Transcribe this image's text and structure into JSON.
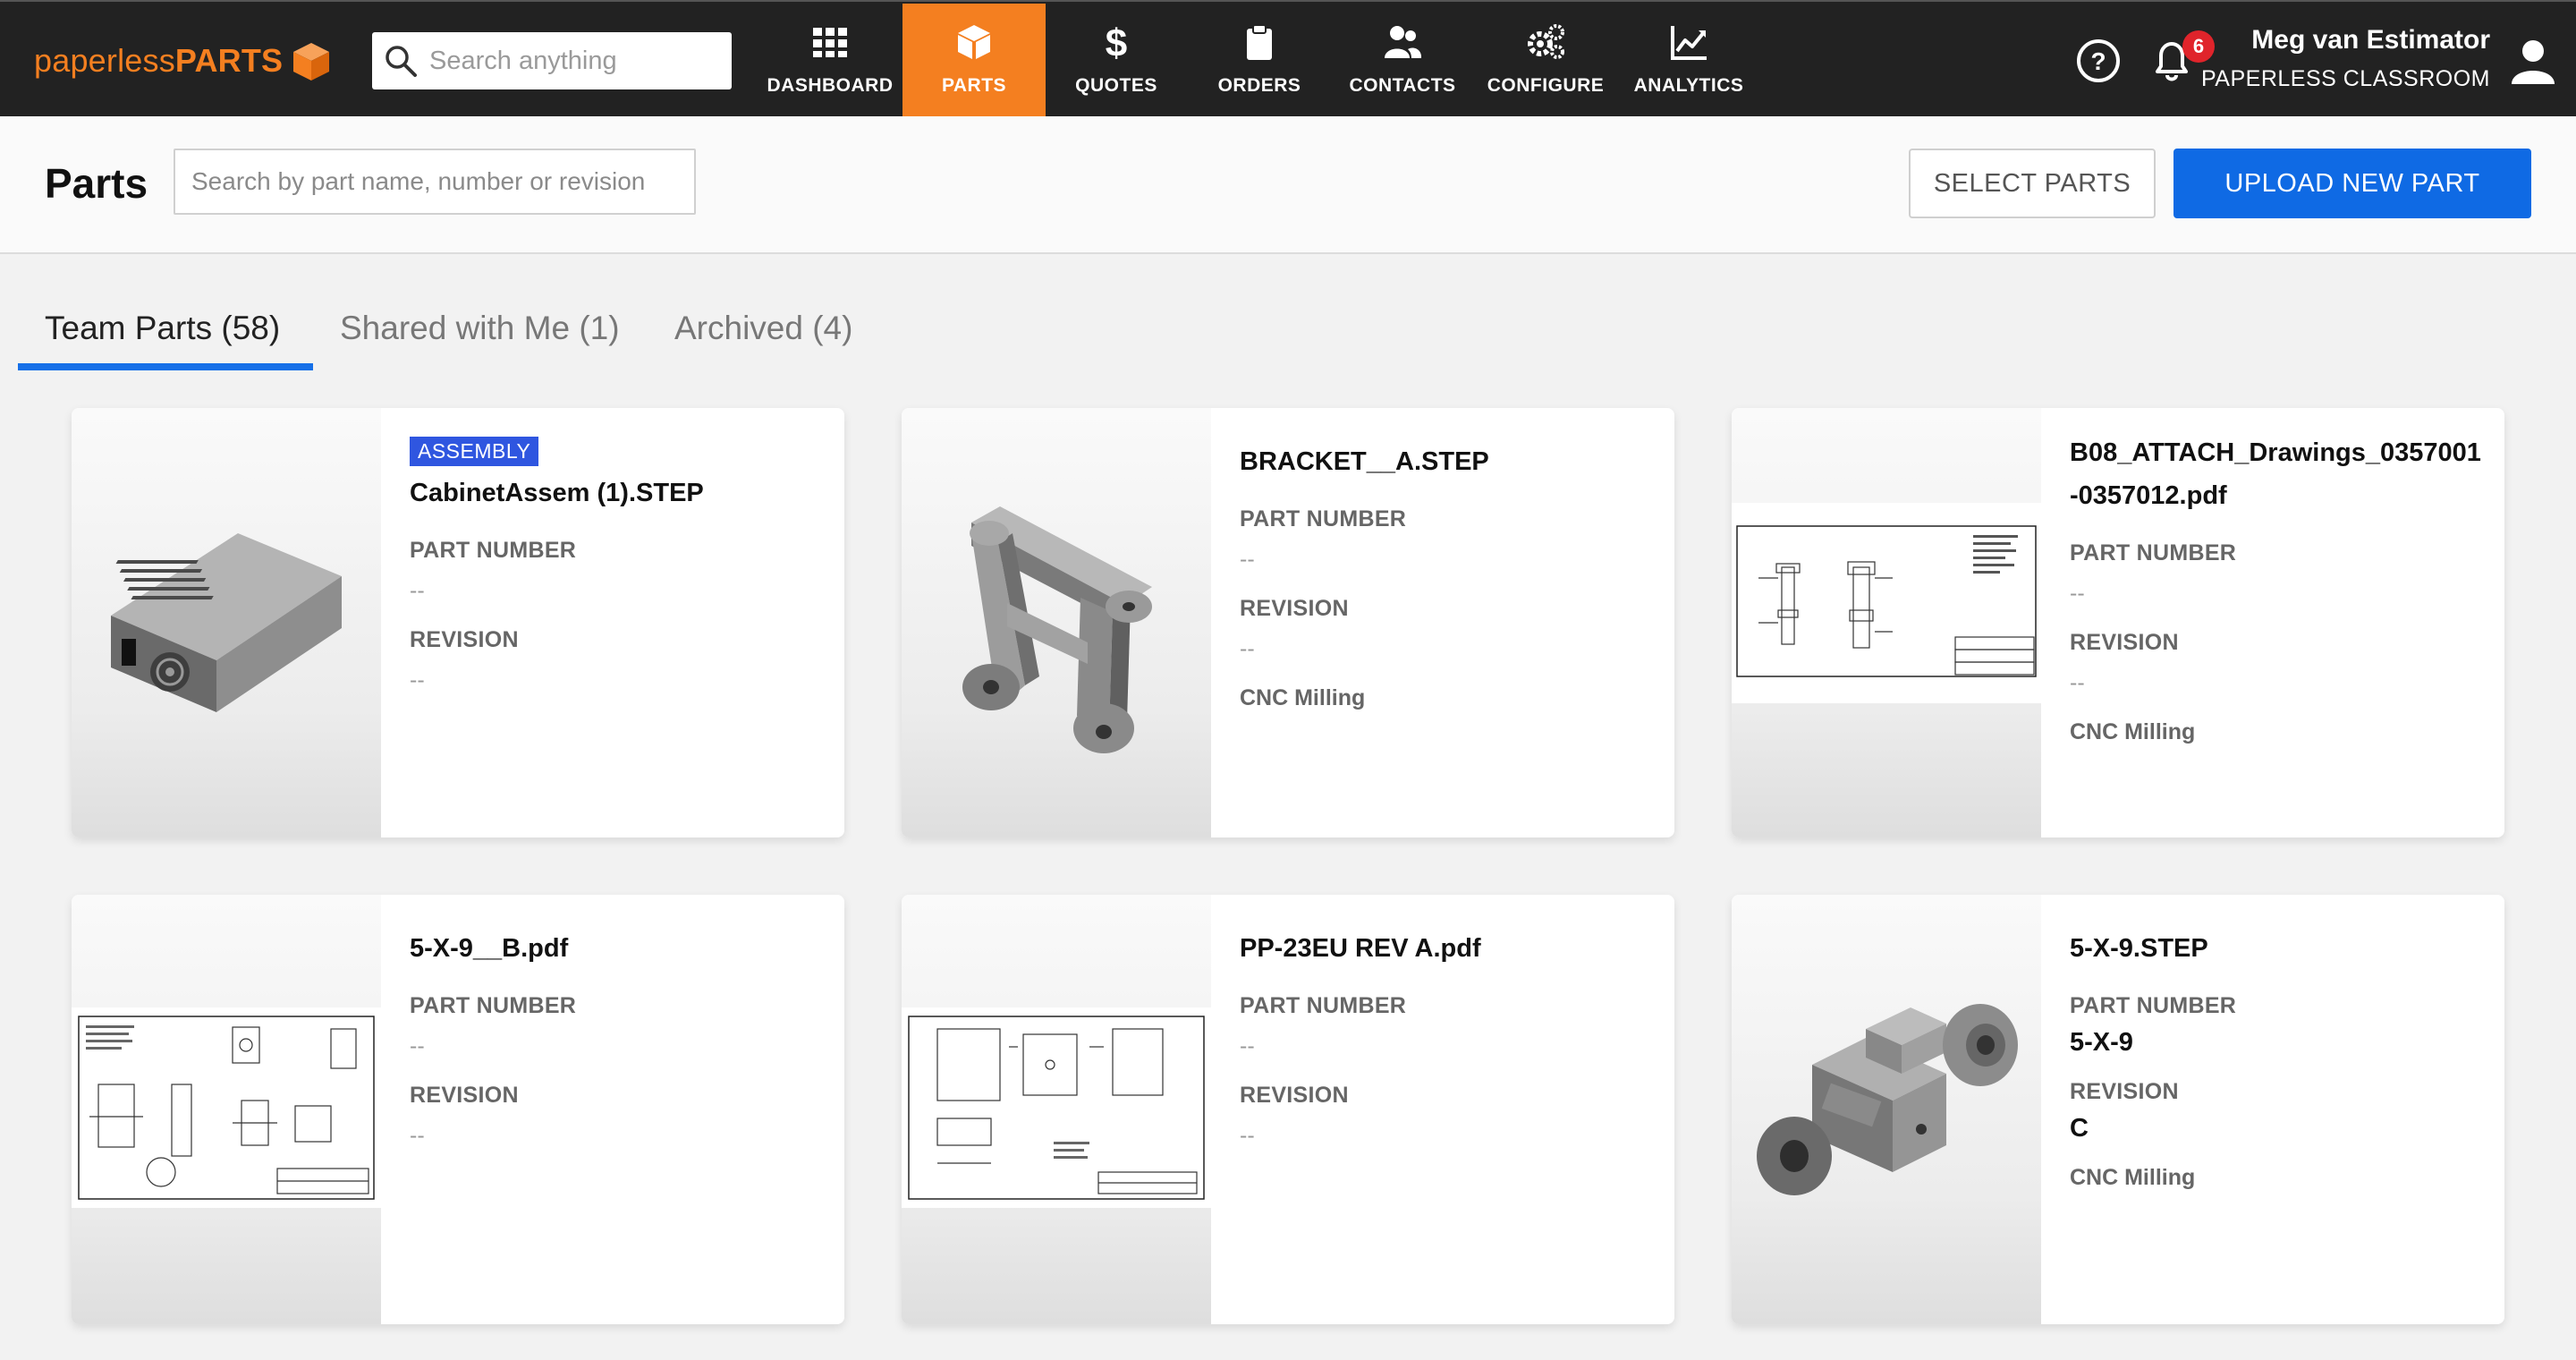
{
  "brand": {
    "name_light": "paperless",
    "name_bold": "PARTS",
    "color": "#f47f20"
  },
  "topbar": {
    "search_placeholder": "Search anything",
    "nav": [
      {
        "label": "DASHBOARD",
        "icon": "grid-icon",
        "active": false
      },
      {
        "label": "PARTS",
        "icon": "cube-icon",
        "active": true
      },
      {
        "label": "QUOTES",
        "icon": "dollar-icon",
        "active": false
      },
      {
        "label": "ORDERS",
        "icon": "clipboard-icon",
        "active": false
      },
      {
        "label": "CONTACTS",
        "icon": "people-icon",
        "active": false
      },
      {
        "label": "CONFIGURE",
        "icon": "gears-icon",
        "active": false
      },
      {
        "label": "ANALYTICS",
        "icon": "chart-line-icon",
        "active": false
      }
    ],
    "notification_count": "6",
    "user_name": "Meg van Estimator",
    "org_name": "PAPERLESS CLASSROOM"
  },
  "page": {
    "title": "Parts",
    "search_placeholder": "Search by part name, number or revision",
    "select_button": "SELECT PARTS",
    "upload_button": "UPLOAD NEW PART"
  },
  "tabs": [
    {
      "label": "Team Parts (58)",
      "active": true
    },
    {
      "label": "Shared with Me (1)",
      "active": false
    },
    {
      "label": "Archived (4)",
      "active": false
    }
  ],
  "labels": {
    "part_number": "PART NUMBER",
    "revision": "REVISION"
  },
  "accent_colors": {
    "primary_blue": "#0f6ae4",
    "tab_underline": "#1670e8",
    "assembly_badge": "#2f56e0",
    "notification_red": "#e0242b"
  },
  "parts": [
    {
      "badge": "ASSEMBLY",
      "name": "CabinetAssem (1).STEP",
      "part_number": "--",
      "revision": "--",
      "process": "",
      "thumbnail": "power-supply-model"
    },
    {
      "badge": "",
      "name": "BRACKET__A.STEP",
      "part_number": "--",
      "revision": "--",
      "process": "CNC Milling",
      "thumbnail": "bracket-model"
    },
    {
      "badge": "",
      "name": "B08_ATTACH_Drawings_0357001-0357012.pdf",
      "part_number": "--",
      "revision": "--",
      "process": "CNC Milling",
      "thumbnail": "drawing-sheet"
    },
    {
      "badge": "",
      "name": "5-X-9__B.pdf",
      "part_number": "--",
      "revision": "--",
      "process": "",
      "thumbnail": "drawing-sheet"
    },
    {
      "badge": "",
      "name": "PP-23EU REV A.pdf",
      "part_number": "--",
      "revision": "--",
      "process": "",
      "thumbnail": "drawing-sheet"
    },
    {
      "badge": "",
      "name": "5-X-9.STEP",
      "part_number": "5-X-9",
      "revision": "C",
      "process": "CNC Milling",
      "thumbnail": "valve-body-model"
    }
  ]
}
